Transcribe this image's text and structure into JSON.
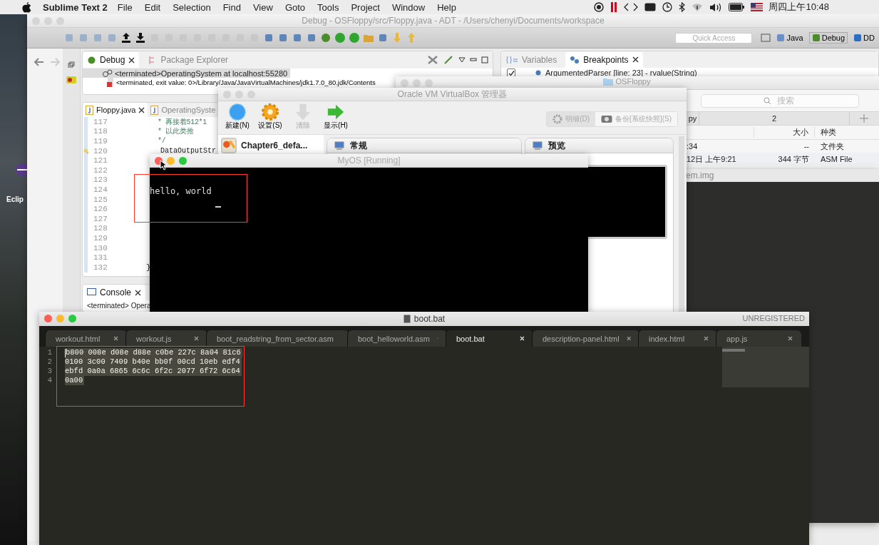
{
  "menu_bar": {
    "app_name": "Sublime Text 2",
    "menus": [
      "File",
      "Edit",
      "Selection",
      "Find",
      "View",
      "Goto",
      "Tools",
      "Project",
      "Window",
      "Help"
    ],
    "clock": "周四上午10:48"
  },
  "desktop": {
    "icon_label": "Eclip"
  },
  "eclipse": {
    "title": "Debug - OSFloppy/src/Floppy.java - ADT - /Users/chenyi/Documents/workspace",
    "quick_access": {
      "placeholder": "Quick Access"
    },
    "perspectives": [
      {
        "label": "Java",
        "selected": false
      },
      {
        "label": "Debug",
        "selected": true
      },
      {
        "label": "DD",
        "selected": false
      }
    ],
    "debug_view": {
      "tabs": [
        {
          "label": "Debug",
          "selected": true
        },
        {
          "label": "Package Explorer",
          "selected": false
        }
      ],
      "items": [
        {
          "kind": "process",
          "label": "<terminated>OperatingSystem at localhost:55280",
          "selected": true
        },
        {
          "kind": "launch",
          "label": "<terminated, exit value: 0>/Library/Java/JavaVirtualMachines/jdk1.7.0_80.jdk/Contents",
          "selected": false
        }
      ]
    },
    "breakpoints_view": {
      "tabs": [
        {
          "label": "Variables",
          "selected": false
        },
        {
          "label": "Breakpoints",
          "selected": true
        }
      ],
      "items": [
        {
          "label": "ArgumentedParser [line: 23] - rvalue(String)",
          "checked": true
        }
      ]
    },
    "editor": {
      "tabs": [
        {
          "label": "Floppy.java",
          "selected": true
        },
        {
          "label": "OperatingSyste",
          "selected": false
        }
      ],
      "lines": [
        {
          "number": "117",
          "kind": "comment",
          "text": "* 再接着512*1",
          "breakpoint": false
        },
        {
          "number": "118",
          "kind": "comment",
          "text": "* 以此类推",
          "breakpoint": false
        },
        {
          "number": "119",
          "kind": "comment",
          "text": "*/",
          "breakpoint": false
        },
        {
          "number": "120",
          "kind": "code",
          "text": "DataOutputStr",
          "breakpoint": true
        },
        {
          "number": "121",
          "breakpoint": false
        },
        {
          "number": "122",
          "breakpoint": false
        },
        {
          "number": "123",
          "breakpoint": false
        },
        {
          "number": "124",
          "breakpoint": false
        },
        {
          "number": "125",
          "breakpoint": false
        },
        {
          "number": "126",
          "breakpoint": false
        },
        {
          "number": "127",
          "breakpoint": false
        },
        {
          "number": "128",
          "breakpoint": false
        },
        {
          "number": "129",
          "breakpoint": false
        },
        {
          "number": "130",
          "breakpoint": false
        },
        {
          "number": "131",
          "breakpoint": false
        },
        {
          "number": "132",
          "kind": "brace",
          "text": "}",
          "breakpoint": false
        }
      ]
    },
    "console": {
      "tab": "Console",
      "text": "<terminated> Opera"
    }
  },
  "finder": {
    "title": "OSFloppy",
    "search": {
      "placeholder": "搜索"
    },
    "tabs": [
      "py",
      "2"
    ],
    "columns": [
      "大小",
      "种类"
    ],
    "rows": [
      {
        "date": ":34",
        "size": "--",
        "kind": "文件夹"
      },
      {
        "date": "12日 上午9:21",
        "size": "344 字节",
        "kind": "ASM File"
      }
    ]
  },
  "image_window": {
    "title": "em.img"
  },
  "virtualbox": {
    "title": "Oracle VM VirtualBox 管理器",
    "tools": [
      {
        "kind": "new",
        "label": "新建(N)",
        "disabled": false
      },
      {
        "kind": "settings",
        "label": "设置(S)",
        "disabled": false
      },
      {
        "kind": "discard",
        "label": "清除",
        "disabled": true
      },
      {
        "kind": "show",
        "label": "显示(H)",
        "disabled": false
      }
    ],
    "view_buttons": [
      {
        "kind": "details",
        "label": "明细(D)",
        "selected": true
      },
      {
        "kind": "snapshots",
        "label": "备份[系统快照](S)",
        "selected": false
      }
    ],
    "vms": [
      {
        "name": "Chapter6_defa..."
      }
    ],
    "panels": [
      "常规",
      "预览"
    ]
  },
  "vm_window": {
    "title": "MyOS [Running]",
    "screen_text": "hello, world"
  },
  "sublime": {
    "title": "boot.bat",
    "license": "UNREGISTERED",
    "tabs": [
      {
        "label": "workout.html",
        "selected": false
      },
      {
        "label": "workout.js",
        "selected": false
      },
      {
        "label": "boot_readstring_from_sector.asm",
        "selected": false
      },
      {
        "label": "boot_helloworld.asm",
        "selected": false
      },
      {
        "label": "boot.bat",
        "selected": true
      },
      {
        "label": "description-panel.html",
        "selected": false
      },
      {
        "label": "index.html",
        "selected": false
      },
      {
        "label": "app.js",
        "selected": false
      }
    ],
    "lines": [
      {
        "number": "1",
        "text": "b800 008e d08e d88e c0be 227c 8a04 81c6"
      },
      {
        "number": "2",
        "text": "0100 3c00 7409 b40e bb0f 00cd 10eb edf4"
      },
      {
        "number": "3",
        "text": "ebfd 0a0a 6865 6c6c 6f2c 2077 6f72 6c64"
      },
      {
        "number": "4",
        "text": "0a00"
      }
    ]
  }
}
